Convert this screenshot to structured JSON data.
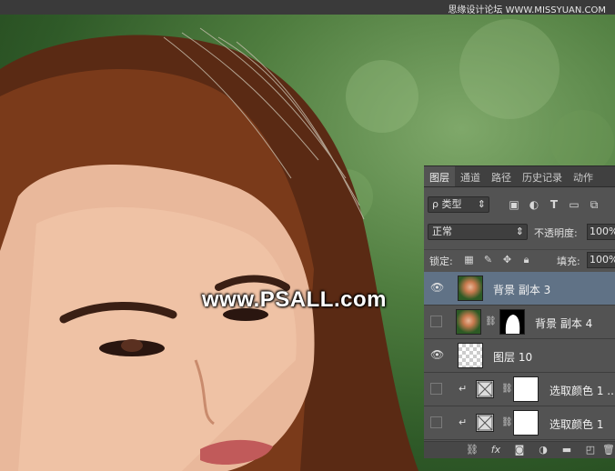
{
  "watermark_top": "思缘设计论坛  WWW.MISSYUAN.COM",
  "photo_watermark": "www.PSALL.com",
  "layers_panel": {
    "tabs": [
      "图层",
      "通道",
      "路径",
      "历史记录",
      "动作"
    ],
    "active_tab": "图层",
    "filter": {
      "kind_label": "ρ 类型",
      "icons": [
        "image-filter-icon",
        "adjustment-filter-icon",
        "type-filter-icon",
        "shape-filter-icon",
        "smart-object-filter-icon"
      ]
    },
    "blend_mode": "正常",
    "opacity_label": "不透明度:",
    "opacity_value": "100%",
    "lock_label": "锁定:",
    "fill_label": "填充:",
    "fill_value": "100%",
    "layers": [
      {
        "name": "背景 副本 3",
        "visible": true,
        "selected": true,
        "thumb": "photo"
      },
      {
        "name": "背景 副本 4",
        "visible": false,
        "selected": false,
        "thumb": "photo",
        "mask": "silhouette"
      },
      {
        "name": "图层 10",
        "visible": true,
        "selected": false,
        "thumb": "transparent"
      },
      {
        "name": "选取颜色 1 ...",
        "visible": false,
        "selected": false,
        "thumb": "adjustment",
        "mask": "white",
        "clipped": true
      },
      {
        "name": "选取颜色 1",
        "visible": false,
        "selected": false,
        "thumb": "adjustment",
        "mask": "white",
        "clipped": true
      }
    ],
    "footer_icons": [
      "link-layers-icon",
      "fx-icon",
      "add-mask-icon",
      "new-adjustment-icon",
      "new-group-icon",
      "new-layer-icon",
      "delete-icon"
    ]
  }
}
